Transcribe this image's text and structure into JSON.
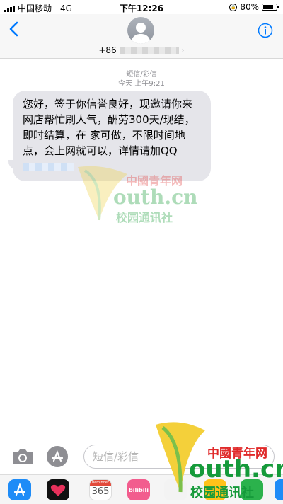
{
  "status_bar": {
    "carrier": "中国移动",
    "network": "4G",
    "time": "下午12:26",
    "battery_percent": "80%",
    "battery_level": 0.8
  },
  "header": {
    "contact_prefix": "+86"
  },
  "thread": {
    "service_label": "短信/彩信",
    "timestamp": "今天 上午9:21",
    "message_text": "您好，签于你信誉良好，现邀请你来网店帮忙刷人气，酬劳300天/现结，即时结算，在 家可做，不限时间地点，会上网就可以，详情请加QQ"
  },
  "watermark": {
    "site_cn": "中國青年网",
    "domain_text": "outh.cn",
    "subtitle": "校园通讯社"
  },
  "compose": {
    "placeholder": "短信/彩信"
  },
  "app_drawer": {
    "calendar_label": "Reminder",
    "calendar_number": "365",
    "bilibili_label": "bilibili"
  },
  "colors": {
    "ios_blue": "#007aff",
    "bubble_gray": "#e5e5ea"
  }
}
